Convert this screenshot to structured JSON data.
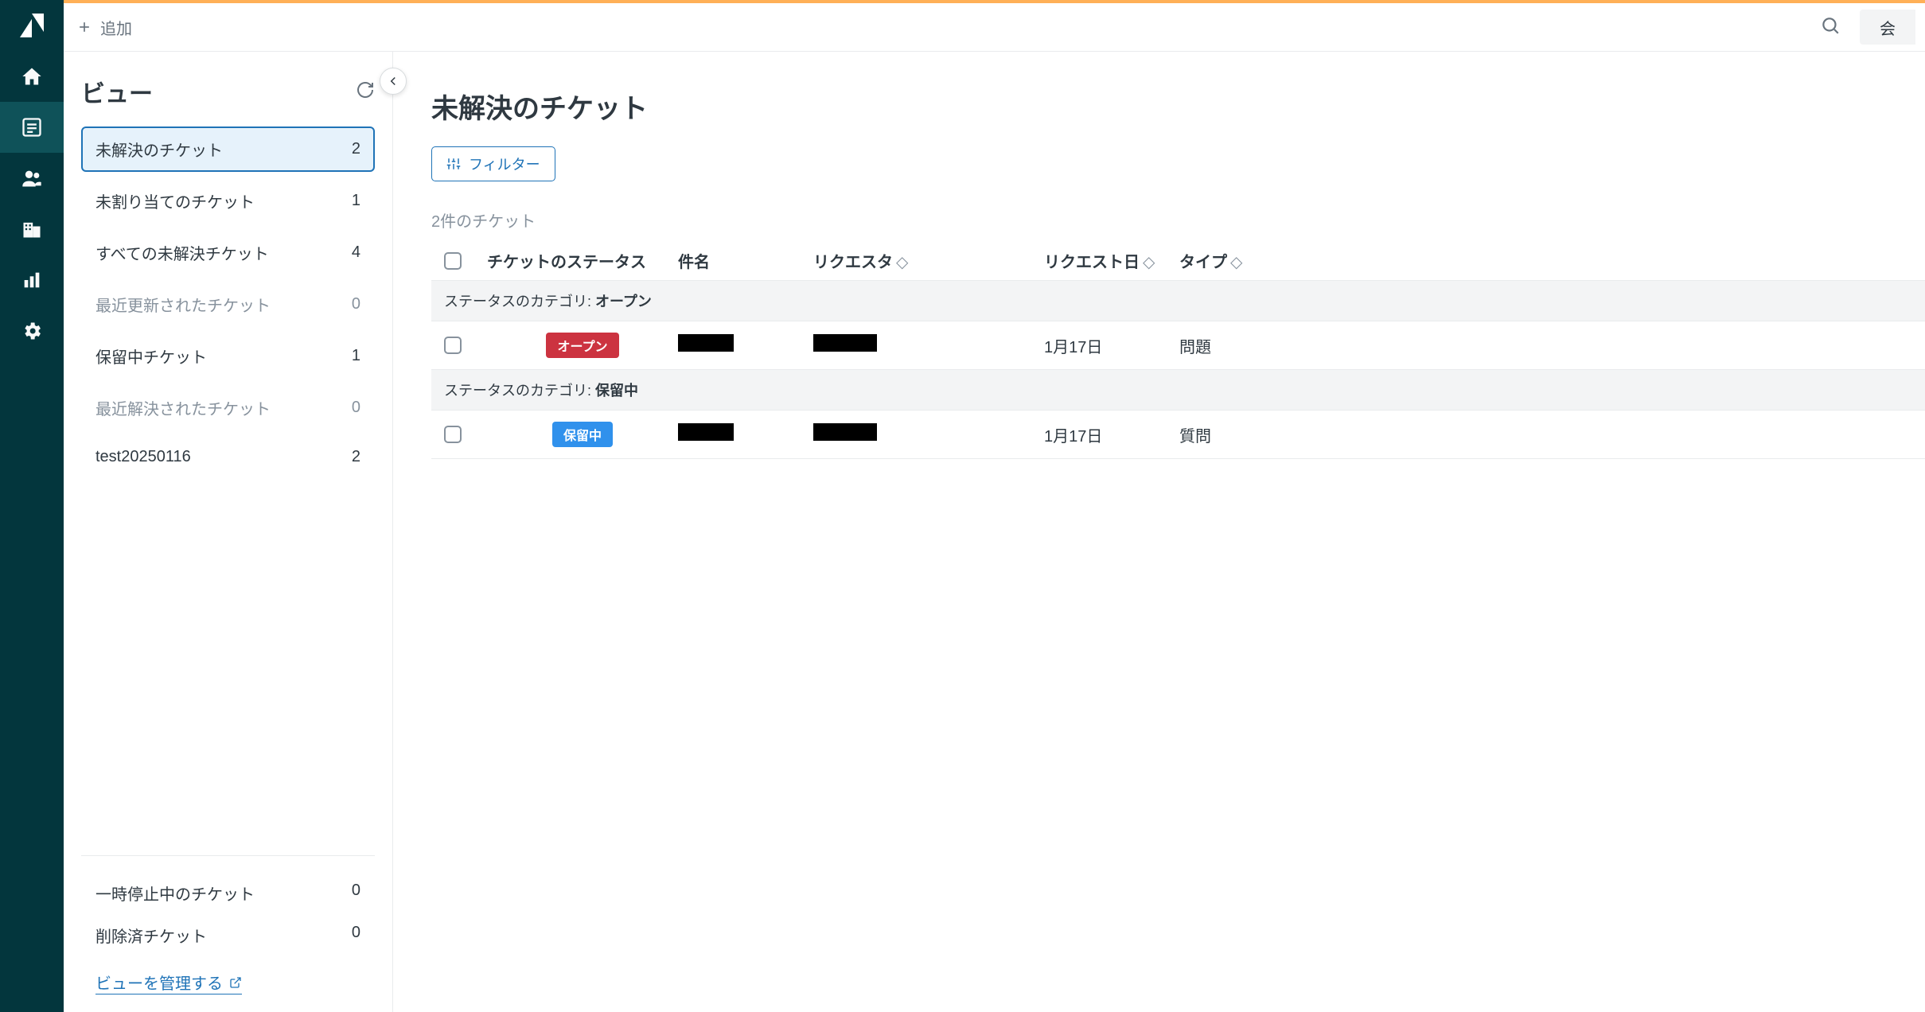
{
  "topbar": {
    "add_label": "追加",
    "right_button": "会"
  },
  "views": {
    "title": "ビュー",
    "items": [
      {
        "label": "未解決のチケット",
        "count": 2,
        "selected": true,
        "dim": false
      },
      {
        "label": "未割り当てのチケット",
        "count": 1,
        "selected": false,
        "dim": false
      },
      {
        "label": "すべての未解決チケット",
        "count": 4,
        "selected": false,
        "dim": false
      },
      {
        "label": "最近更新されたチケット",
        "count": 0,
        "selected": false,
        "dim": true
      },
      {
        "label": "保留中チケット",
        "count": 1,
        "selected": false,
        "dim": false
      },
      {
        "label": "最近解決されたチケット",
        "count": 0,
        "selected": false,
        "dim": true
      },
      {
        "label": "test20250116",
        "count": 2,
        "selected": false,
        "dim": false
      }
    ],
    "footer": [
      {
        "label": "一時停止中のチケット",
        "count": 0
      },
      {
        "label": "削除済チケット",
        "count": 0
      }
    ],
    "manage_link": "ビューを管理する"
  },
  "main": {
    "title": "未解決のチケット",
    "filter_label": "フィルター",
    "count_text": "2件のチケット",
    "columns": {
      "status": "チケットのステータス",
      "subject": "件名",
      "requester": "リクエスタ",
      "requested_date": "リクエスト日",
      "type": "タイプ"
    },
    "group_label": "ステータスのカテゴリ:",
    "groups": [
      {
        "value": "オープン",
        "rows": [
          {
            "status": "オープン",
            "status_class": "open",
            "subject": "█████",
            "requester": "█████",
            "date": "1月17日",
            "type": "問題"
          }
        ]
      },
      {
        "value": "保留中",
        "rows": [
          {
            "status": "保留中",
            "status_class": "hold",
            "subject": "██████",
            "requester": "██████",
            "date": "1月17日",
            "type": "質問"
          }
        ]
      }
    ]
  }
}
